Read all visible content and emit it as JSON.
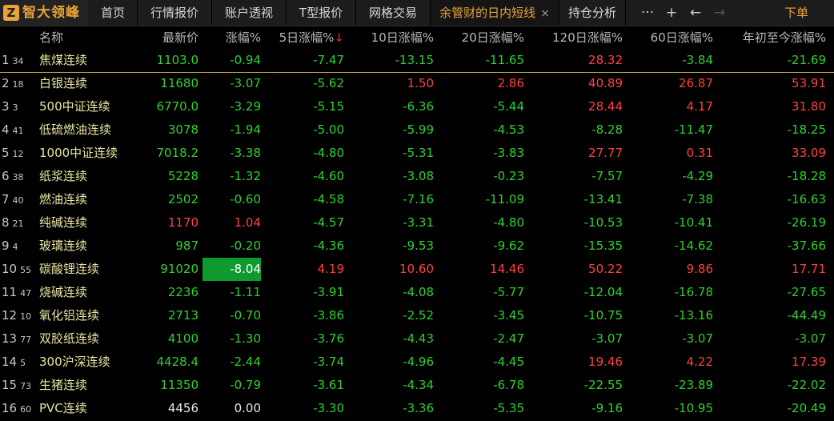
{
  "app": {
    "logo_mark": "Z",
    "logo_text": "智大领峰"
  },
  "tabs": [
    {
      "label": "首页"
    },
    {
      "label": "行情报价"
    },
    {
      "label": "账户透视"
    },
    {
      "label": "T型报价"
    },
    {
      "label": "网格交易"
    },
    {
      "label": "余管财的日内短线",
      "close": "×"
    },
    {
      "label": "持仓分析"
    }
  ],
  "toolbar": {
    "more": "···",
    "add": "+",
    "back": "←",
    "forward": "→",
    "download": "下单"
  },
  "columns": {
    "name": "名称",
    "price": "最新价",
    "chg": "涨幅%",
    "d5": "5日涨幅%",
    "d5_sort": "↓",
    "d10": "10日涨幅%",
    "d20": "20日涨幅%",
    "d120": "120日涨幅%",
    "d60": "60日涨幅%",
    "ytd": "年初至今涨幅%"
  },
  "colors": {
    "up": "#ff4040",
    "down": "#2fd02f",
    "accent": "#e8a33a",
    "highlight_bg": "#0f9a2f"
  },
  "rows": [
    {
      "idx": "1",
      "sub": "34",
      "name": "焦煤连续",
      "price": "1103.0",
      "chg": "-0.94",
      "d5": "-7.47",
      "d10": "-13.15",
      "d20": "-11.65",
      "d120": "28.32",
      "d60": "-3.84",
      "ytd": "-21.69"
    },
    {
      "idx": "2",
      "sub": "18",
      "name": "白银连续",
      "price": "11680",
      "chg": "-3.07",
      "d5": "-5.62",
      "d10": "1.50",
      "d20": "2.86",
      "d120": "40.89",
      "d60": "26.87",
      "ytd": "53.91"
    },
    {
      "idx": "3",
      "sub": "3",
      "name": "500中证连续",
      "price": "6770.0",
      "chg": "-3.29",
      "d5": "-5.15",
      "d10": "-6.36",
      "d20": "-5.44",
      "d120": "28.44",
      "d60": "4.17",
      "ytd": "31.80"
    },
    {
      "idx": "4",
      "sub": "41",
      "name": "低硫燃油连续",
      "price": "3078",
      "chg": "-1.94",
      "d5": "-5.00",
      "d10": "-5.99",
      "d20": "-4.53",
      "d120": "-8.28",
      "d60": "-11.47",
      "ytd": "-18.25"
    },
    {
      "idx": "5",
      "sub": "12",
      "name": "1000中证连续",
      "price": "7018.2",
      "chg": "-3.38",
      "d5": "-4.80",
      "d10": "-5.31",
      "d20": "-3.83",
      "d120": "27.77",
      "d60": "0.31",
      "ytd": "33.09"
    },
    {
      "idx": "6",
      "sub": "38",
      "name": "纸浆连续",
      "price": "5228",
      "chg": "-1.32",
      "d5": "-4.60",
      "d10": "-3.08",
      "d20": "-0.23",
      "d120": "-7.57",
      "d60": "-4.29",
      "ytd": "-18.28"
    },
    {
      "idx": "7",
      "sub": "40",
      "name": "燃油连续",
      "price": "2502",
      "chg": "-0.60",
      "d5": "-4.58",
      "d10": "-7.16",
      "d20": "-11.09",
      "d120": "-13.41",
      "d60": "-7.38",
      "ytd": "-16.63"
    },
    {
      "idx": "8",
      "sub": "21",
      "name": "纯碱连续",
      "price": "1170",
      "chg": "1.04",
      "d5": "-4.57",
      "d10": "-3.31",
      "d20": "-4.80",
      "d120": "-10.53",
      "d60": "-10.41",
      "ytd": "-26.19"
    },
    {
      "idx": "9",
      "sub": "4",
      "name": "玻璃连续",
      "price": "987",
      "chg": "-0.20",
      "d5": "-4.36",
      "d10": "-9.53",
      "d20": "-9.62",
      "d120": "-15.35",
      "d60": "-14.62",
      "ytd": "-37.66"
    },
    {
      "idx": "10",
      "sub": "55",
      "name": "碳酸锂连续",
      "price": "91020",
      "chg": "-8.04",
      "d5": "4.19",
      "d10": "10.60",
      "d20": "14.46",
      "d120": "50.22",
      "d60": "9.86",
      "ytd": "17.71",
      "chg_highlight": true
    },
    {
      "idx": "11",
      "sub": "47",
      "name": "烧碱连续",
      "price": "2236",
      "chg": "-1.11",
      "d5": "-3.91",
      "d10": "-4.08",
      "d20": "-5.77",
      "d120": "-12.04",
      "d60": "-16.78",
      "ytd": "-27.65"
    },
    {
      "idx": "12",
      "sub": "10",
      "name": "氧化铝连续",
      "price": "2713",
      "chg": "-0.70",
      "d5": "-3.86",
      "d10": "-2.52",
      "d20": "-3.45",
      "d120": "-10.75",
      "d60": "-13.16",
      "ytd": "-44.49"
    },
    {
      "idx": "13",
      "sub": "77",
      "name": "双胶纸连续",
      "price": "4100",
      "chg": "-1.30",
      "d5": "-3.76",
      "d10": "-4.43",
      "d20": "-2.47",
      "d120": "-3.07",
      "d60": "-3.07",
      "ytd": "-3.07"
    },
    {
      "idx": "14",
      "sub": "5",
      "name": "300沪深连续",
      "price": "4428.4",
      "chg": "-2.44",
      "d5": "-3.74",
      "d10": "-4.96",
      "d20": "-4.45",
      "d120": "19.46",
      "d60": "4.22",
      "ytd": "17.39"
    },
    {
      "idx": "15",
      "sub": "73",
      "name": "生猪连续",
      "price": "11350",
      "chg": "-0.79",
      "d5": "-3.61",
      "d10": "-4.34",
      "d20": "-6.78",
      "d120": "-22.55",
      "d60": "-23.89",
      "ytd": "-22.02"
    },
    {
      "idx": "16",
      "sub": "60",
      "name": "PVC连续",
      "price": "4456",
      "chg": "0.00",
      "d5": "-3.30",
      "d10": "-3.36",
      "d20": "-5.35",
      "d120": "-9.16",
      "d60": "-10.95",
      "ytd": "-20.49"
    }
  ]
}
